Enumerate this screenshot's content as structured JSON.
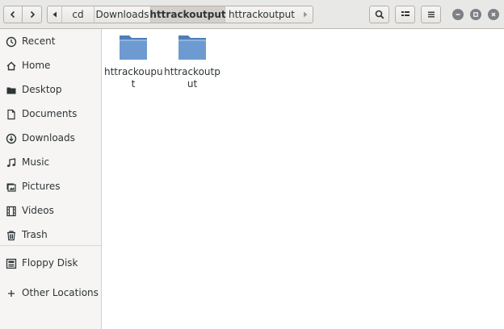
{
  "path_bar": {
    "segments": [
      "cd",
      "Downloads",
      "httrackoutput",
      "httrackoutput"
    ],
    "active_index": 2
  },
  "sidebar": {
    "items": [
      {
        "label": "Recent",
        "icon": "clock-icon"
      },
      {
        "label": "Home",
        "icon": "home-icon"
      },
      {
        "label": "Desktop",
        "icon": "desktop-folder-icon"
      },
      {
        "label": "Documents",
        "icon": "document-icon"
      },
      {
        "label": "Downloads",
        "icon": "download-icon"
      },
      {
        "label": "Music",
        "icon": "music-note-icon"
      },
      {
        "label": "Pictures",
        "icon": "picture-icon"
      },
      {
        "label": "Videos",
        "icon": "film-icon"
      },
      {
        "label": "Trash",
        "icon": "trash-icon"
      },
      {
        "label": "Floppy Disk",
        "icon": "floppy-disk-icon"
      },
      {
        "label": "Other Locations",
        "icon": "plus-icon"
      }
    ]
  },
  "files": [
    {
      "label_line1": "httrackoupu",
      "label_line2": "t",
      "icon": "folder-icon"
    },
    {
      "label_line1": "httrackoutp",
      "label_line2": "ut",
      "icon": "folder-icon"
    }
  ],
  "colors": {
    "headerbar_bg": "#e8e8e7",
    "sidebar_bg": "#f6f5f4",
    "folder_blue": "#6d9bd1",
    "window_control": "#7e8087"
  }
}
